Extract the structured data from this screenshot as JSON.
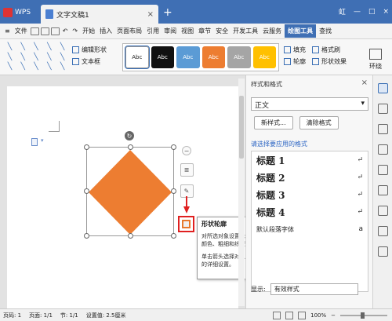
{
  "titlebar": {
    "app_name": "WPS",
    "doc_tab": "文字文稿1",
    "add_tab": "+",
    "user": "虹"
  },
  "menubar": {
    "file": "文件",
    "items": [
      "开始",
      "插入",
      "页面布局",
      "引用",
      "审阅",
      "视图",
      "章节",
      "安全",
      "开发工具",
      "云服务",
      "绘图工具"
    ],
    "active": "绘图工具",
    "search": "查找"
  },
  "ribbon": {
    "edit_shape": "编辑形状",
    "text_box": "文本框",
    "style_buttons": [
      "Abc",
      "Abc",
      "Abc",
      "Abc",
      "Abc",
      "Abc"
    ],
    "style_colors": [
      "#ffffff",
      "#111111",
      "#5b9bd5",
      "#ed7d31",
      "#a5a5a5",
      "#ffc000"
    ],
    "fill": "填充",
    "format_brush": "格式刷",
    "outline": "轮廓",
    "shape_effects": "形状效果",
    "environment": "环绕"
  },
  "document": {
    "shape_color": "#ed7d31",
    "tooltip_title": "形状轮廓",
    "tooltip_line1": "对所选对象设置轮廓的颜色、粗细和线型。",
    "tooltip_line2": "单击箭头选择对象轮廓的详细设置。"
  },
  "panel": {
    "title": "样式和格式",
    "current_style": "正文",
    "new_style": "新样式...",
    "clear_format": "清除格式",
    "apply_label": "请选择要应用的格式",
    "styles": [
      "标题  1",
      "标题  2",
      "标题  3",
      "标题  4"
    ],
    "default_font": "默认段落字体",
    "show_label": "显示:",
    "show_value": "有效样式"
  },
  "status": {
    "page": "页码: 1",
    "pages": "页面: 1/1",
    "section": "节: 1/1",
    "setting": "设置值: 2.5厘米",
    "zoom": "100%"
  }
}
